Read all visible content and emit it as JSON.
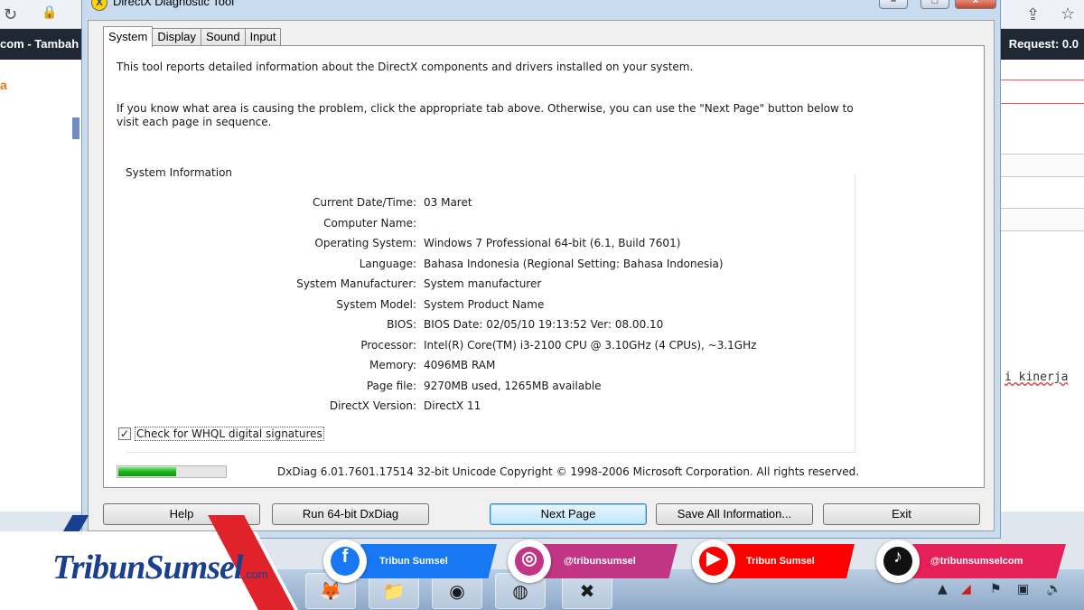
{
  "window": {
    "title": "DirectX Diagnostic Tool",
    "controls": {
      "minimize": "–",
      "maximize": "□",
      "close": "×"
    }
  },
  "tabs": [
    "System",
    "Display",
    "Sound",
    "Input"
  ],
  "active_tab": "System",
  "intro": {
    "line1": "This tool reports detailed information about the DirectX components and drivers installed on your system.",
    "line2": "If you know what area is causing the problem, click the appropriate tab above.  Otherwise, you can use the \"Next Page\" button below to visit each page in sequence."
  },
  "system_information": {
    "title": "System Information",
    "rows": [
      {
        "label": "Current Date/Time:",
        "value": "03 Maret"
      },
      {
        "label": "Computer Name:",
        "value": ""
      },
      {
        "label": "Operating System:",
        "value": "Windows 7 Professional 64-bit (6.1, Build 7601)"
      },
      {
        "label": "Language:",
        "value": "Bahasa Indonesia (Regional Setting: Bahasa Indonesia)"
      },
      {
        "label": "System Manufacturer:",
        "value": "System manufacturer"
      },
      {
        "label": "System Model:",
        "value": "System Product Name"
      },
      {
        "label": "BIOS:",
        "value": "BIOS Date: 02/05/10 19:13:52 Ver: 08.00.10"
      },
      {
        "label": "Processor:",
        "value": "Intel(R) Core(TM) i3-2100 CPU @ 3.10GHz (4 CPUs), ~3.1GHz"
      },
      {
        "label": "Memory:",
        "value": "4096MB RAM"
      },
      {
        "label": "Page file:",
        "value": "9270MB used, 1265MB available"
      },
      {
        "label": "DirectX Version:",
        "value": "DirectX 11"
      }
    ]
  },
  "whql_checkbox": {
    "label": "Check for WHQL digital signatures",
    "checked": true,
    "mark": "✓"
  },
  "progress": {
    "fraction": 0.55,
    "color": "#17b517"
  },
  "copyright": "DxDiag 6.01.7601.17514 32-bit Unicode  Copyright © 1998-2006 Microsoft Corporation.  All rights reserved.",
  "buttons": {
    "help": "Help",
    "run64": "Run 64-bit DxDiag",
    "next": "Next Page",
    "save": "Save All Information...",
    "exit": "Exit"
  },
  "background_browser": {
    "tab_left_text": "com - Tambah",
    "tab_right_text": "Request: 0.0",
    "left_text": "a",
    "right_text": "i kinerja"
  },
  "brand": {
    "logo_text": "TribunSumsel",
    "logo_suffix": ".com",
    "facebook": "Tribun Sumsel",
    "instagram": "@tribunsumsel",
    "youtube": "Tribun Sumsel",
    "tiktok": "@tribunsumselcom",
    "colors": {
      "navy": "#1b3f8f",
      "red": "#e0232b",
      "facebook": "#1877f2",
      "instagram": "#c13584",
      "youtube": "#ff0000",
      "tiktok": "#e6215a"
    }
  }
}
